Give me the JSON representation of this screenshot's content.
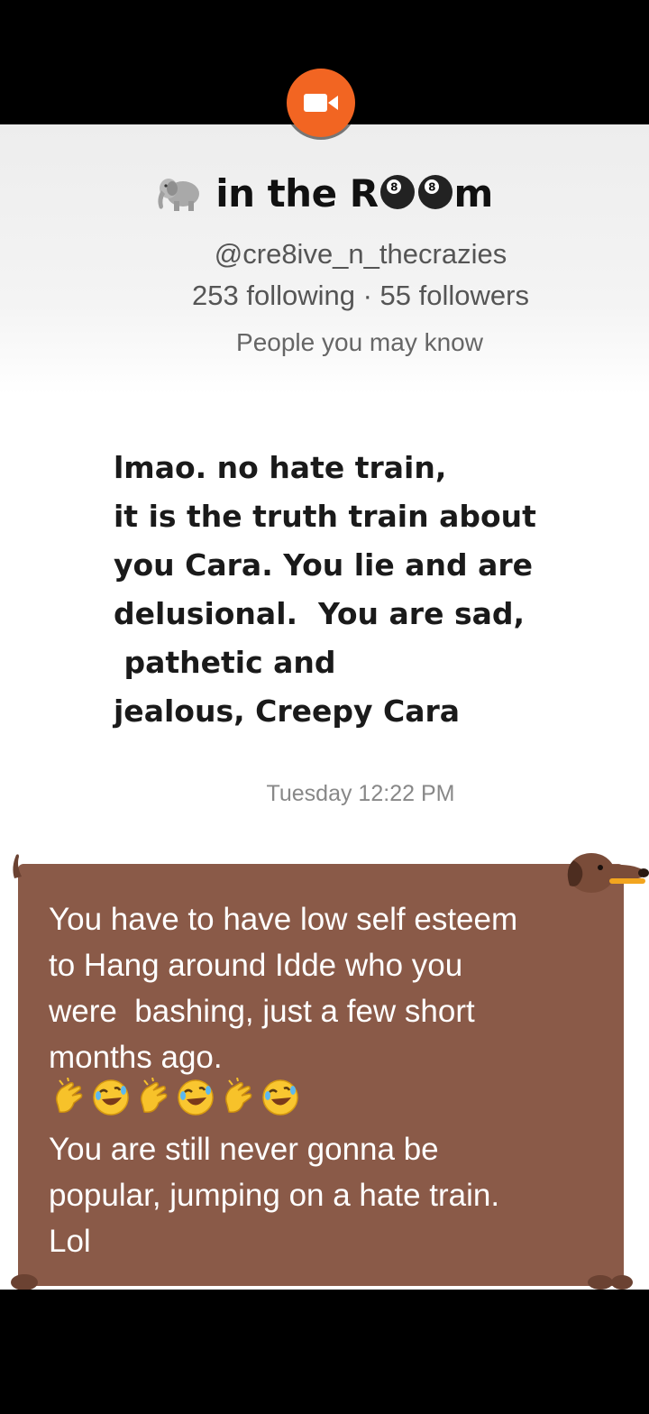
{
  "recorder": {
    "icon": "video-camera-icon",
    "accent": "#f26522"
  },
  "profile": {
    "name_prefix": "in the R",
    "name_suffix": "m",
    "name_icons": [
      "elephant-icon",
      "eight-ball-icon",
      "eight-ball-icon"
    ],
    "handle": "@cre8ive_n_thecrazies",
    "stats": "253 following · 55 followers",
    "people_label": "People you may know"
  },
  "message": {
    "lines": [
      "lmao. no hate train,",
      "it is the truth train about",
      "you Cara. You lie and are",
      "delusional.  You are sad,",
      " pathetic and",
      "jealous, Creepy Cara"
    ]
  },
  "timestamp": "Tuesday 12:22 PM",
  "note": {
    "background": "#8a5a48",
    "lines_top": [
      "You have to have low self esteem",
      "to Hang around Idde who you",
      "were  bashing, just a few short",
      "months ago."
    ],
    "emojis": [
      "clapping-hand-icon",
      "rofl-face-icon",
      "clapping-hand-icon",
      "rofl-face-icon",
      "clapping-hand-icon",
      "rofl-face-icon"
    ],
    "lines_bottom": [
      "You are still never gonna be",
      "popular, jumping on a hate train.",
      "Lol"
    ],
    "decoration": "dachshund-icon"
  }
}
